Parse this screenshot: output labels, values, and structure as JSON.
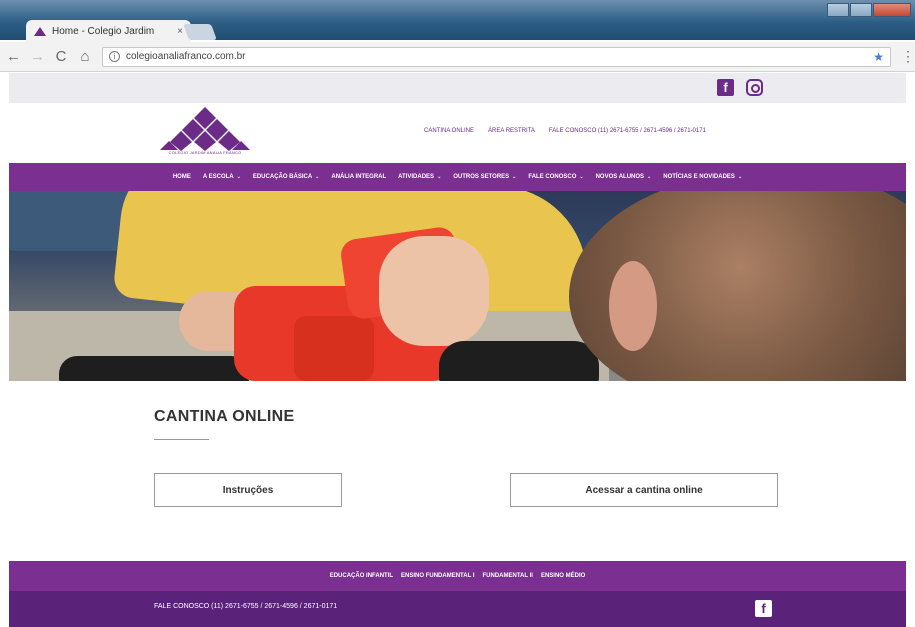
{
  "browser": {
    "tab_title": "Home - Colegio Jardim",
    "tab_close": "×",
    "url": "colegioanaliafranco.com.br",
    "back_icon": "←",
    "forward_icon": "→",
    "reload_icon": "C",
    "home_icon": "⌂",
    "info_icon": "i",
    "star_icon": "★",
    "menu_icon": "⋮"
  },
  "social": {
    "facebook_glyph": "f"
  },
  "logo": {
    "text": "COLEGIO JARDIM ANALIA FRANCO"
  },
  "header_links": [
    {
      "label": "CANTINA ONLINE"
    },
    {
      "label": "ÁREA RESTRITA"
    },
    {
      "label": "FALE CONOSCO (11) 2671-6755 / 2671-4596 / 2671-0171"
    }
  ],
  "nav": [
    {
      "label": "HOME",
      "dropdown": false
    },
    {
      "label": "A ESCOLA",
      "dropdown": true
    },
    {
      "label": "EDUCAÇÃO BÁSICA",
      "dropdown": true
    },
    {
      "label": "ANÁLIA INTEGRAL",
      "dropdown": false
    },
    {
      "label": "ATIVIDADES",
      "dropdown": true
    },
    {
      "label": "OUTROS SETORES",
      "dropdown": true
    },
    {
      "label": "FALE CONOSCO",
      "dropdown": true
    },
    {
      "label": "NOVOS ALUNOS",
      "dropdown": true
    },
    {
      "label": "NOTÍCIAS E NOVIDADES",
      "dropdown": true
    }
  ],
  "nav_chevron": "⌄",
  "content": {
    "title": "CANTINA ONLINE",
    "button_instructions": "Instruções",
    "button_access": "Acessar a cantina online"
  },
  "footer": {
    "links": [
      {
        "label": "EDUCAÇÃO INFANTIL"
      },
      {
        "label": "ENSINO FUNDAMENTAL I"
      },
      {
        "label": "FUNDAMENTAL II"
      },
      {
        "label": "ENSINO MÉDIO"
      }
    ],
    "contact": "FALE CONOSCO (11) 2671-6755 / 2671-4596 / 2671-0171",
    "facebook_glyph": "f"
  },
  "colors": {
    "brand_purple": "#7a2f91",
    "footer_dark": "#5b2279"
  }
}
